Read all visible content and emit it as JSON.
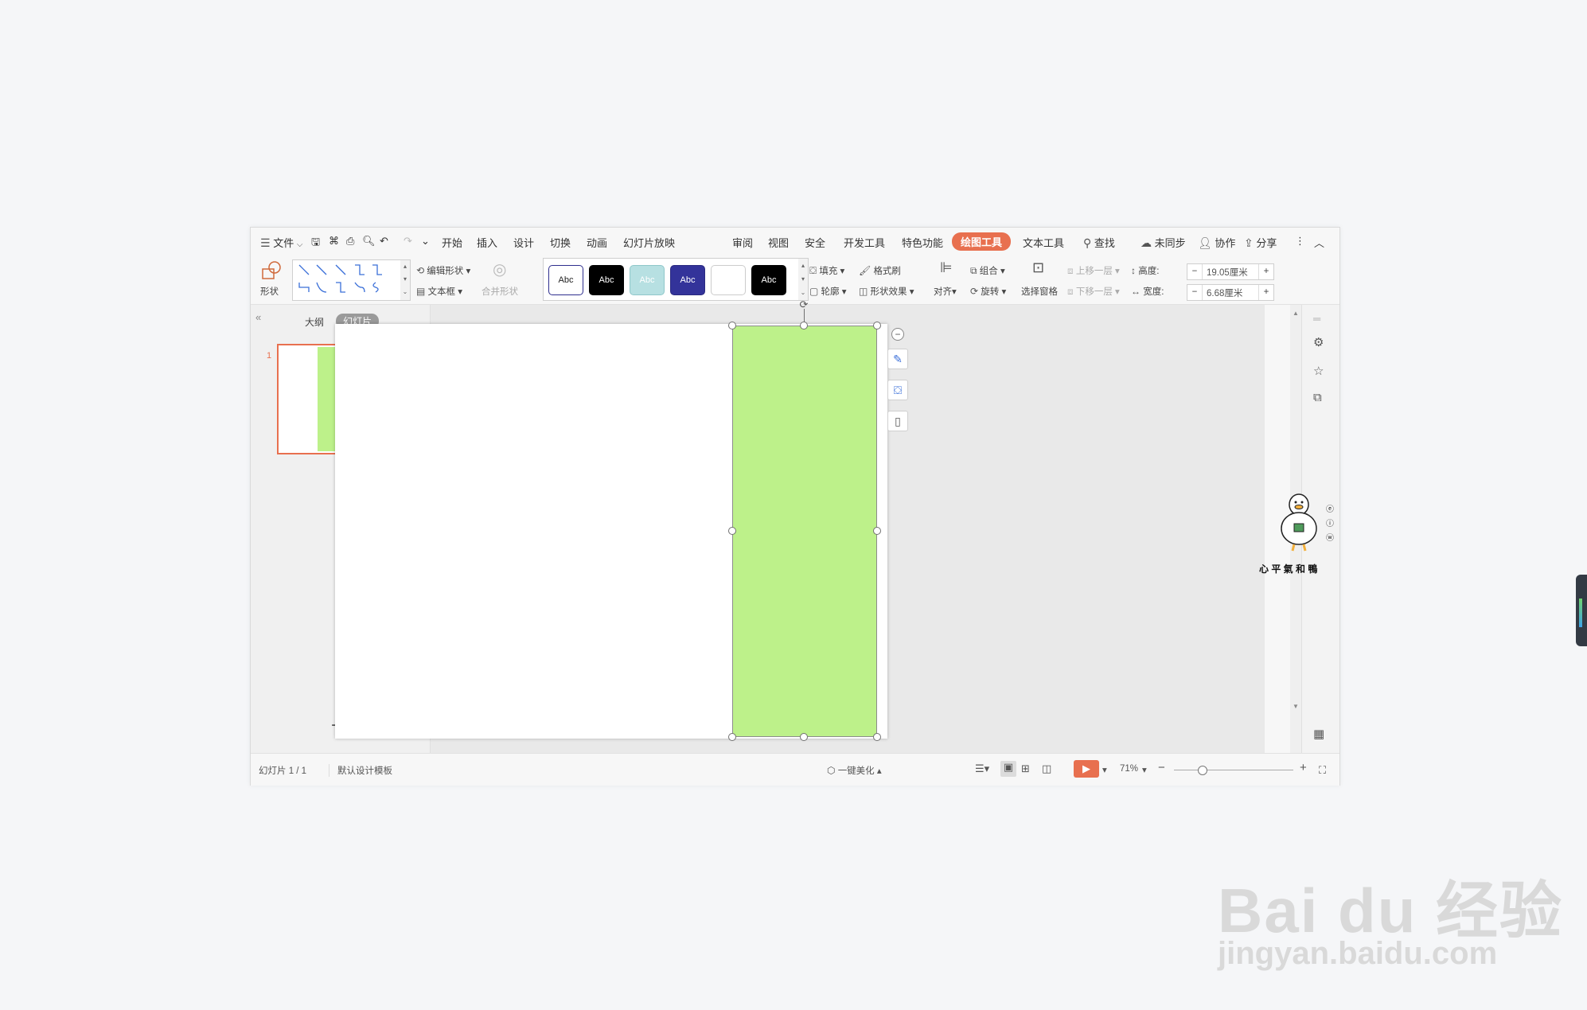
{
  "menubar": {
    "file_label": "文件",
    "tabs": [
      "开始",
      "插入",
      "设计",
      "切换",
      "动画",
      "幻灯片放映",
      "审阅",
      "视图",
      "安全",
      "开发工具",
      "特色功能",
      "绘图工具",
      "文本工具"
    ],
    "active_tab": "绘图工具",
    "search_label": "查找",
    "sync_label": "未同步",
    "collab_label": "协作",
    "share_label": "分享"
  },
  "ribbon": {
    "shape_label": "形状",
    "edit_shape_label": "编辑形状",
    "textbox_label": "文本框",
    "merge_shape_label": "合并形状",
    "style_swatches": [
      {
        "text": "Abc",
        "bg": "#ffffff",
        "fg": "#222222",
        "border": "#2e2e8e"
      },
      {
        "text": "Abc",
        "bg": "#000000",
        "fg": "#ffffff",
        "border": "#000000"
      },
      {
        "text": "Abc",
        "bg": "#b7e0e2",
        "fg": "#ffffff",
        "border": "#8fc7ca"
      },
      {
        "text": "Abc",
        "bg": "#33339a",
        "fg": "#ffffff",
        "border": "#2a2a80"
      },
      {
        "text": "",
        "bg": "#ffffff",
        "fg": "#222222",
        "border": "#cccccc"
      },
      {
        "text": "Abc",
        "bg": "#000000",
        "fg": "#ffffff",
        "border": "#000000"
      }
    ],
    "fill_label": "填充",
    "format_painter_label": "格式刷",
    "outline_label": "轮廓",
    "shape_effect_label": "形状效果",
    "align_label": "对齐",
    "group_label": "组合",
    "rotate_label": "旋转",
    "selection_pane_label": "选择窗格",
    "bring_forward_label": "上移一层",
    "send_backward_label": "下移一层",
    "height_label": "高度:",
    "height_value": "19.05厘米",
    "width_label": "宽度:",
    "width_value": "6.68厘米"
  },
  "leftpane": {
    "outline_tab": "大纲",
    "slides_tab": "幻灯片",
    "slide_number": "1",
    "add_label": "+"
  },
  "statusbar": {
    "slide_info": "幻灯片 1 / 1",
    "template": "默认设计模板",
    "beautify": "一键美化",
    "zoom": "71%",
    "zoom_level": 0.71
  },
  "sticker": {
    "caption": "心 平 氣 和 鴨"
  },
  "watermark": {
    "brand": "Bai du 经验",
    "url": "jingyan.baidu.com"
  },
  "colors": {
    "accent": "#e8704f",
    "shape_fill": "#bdf18a",
    "play": "#e8704f"
  }
}
